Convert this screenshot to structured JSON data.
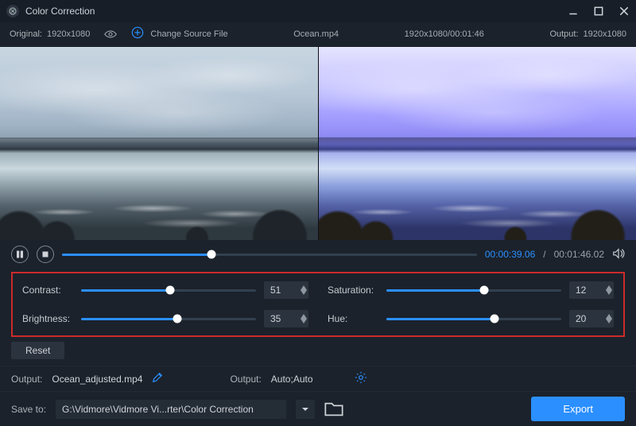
{
  "window": {
    "title": "Color Correction"
  },
  "subbar": {
    "original_label": "Original:",
    "original_res": "1920x1080",
    "change_source": "Change Source File",
    "filename": "Ocean.mp4",
    "file_info": "1920x1080/00:01:46",
    "output_label": "Output:",
    "output_res": "1920x1080"
  },
  "transport": {
    "current": "00:00:39.06",
    "total": "00:01:46.02",
    "progress_pct": 36
  },
  "adjust": {
    "contrast": {
      "label": "Contrast:",
      "value": 51,
      "pct": 51
    },
    "saturation": {
      "label": "Saturation:",
      "value": 12,
      "pct": 56
    },
    "brightness": {
      "label": "Brightness:",
      "value": 35,
      "pct": 55
    },
    "hue": {
      "label": "Hue:",
      "value": 20,
      "pct": 62
    }
  },
  "reset_label": "Reset",
  "output_file": {
    "label": "Output:",
    "name": "Ocean_adjusted.mp4"
  },
  "output_fmt": {
    "label": "Output:",
    "value": "Auto;Auto"
  },
  "save": {
    "label": "Save to:",
    "path": "G:\\Vidmore\\Vidmore Vi...rter\\Color Correction"
  },
  "export_label": "Export"
}
